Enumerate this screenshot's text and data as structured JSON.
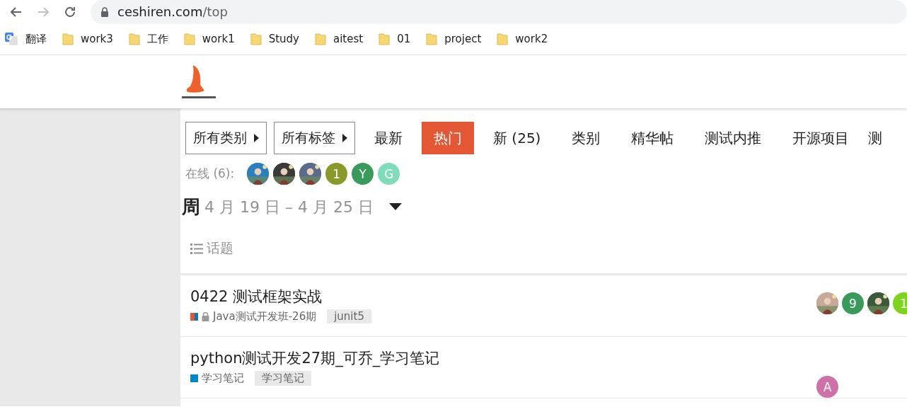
{
  "browser": {
    "url_host": "ceshiren.com",
    "url_path": "/top",
    "bookmarks": [
      {
        "kind": "translate",
        "label": "翻译"
      },
      {
        "kind": "folder",
        "label": "work3"
      },
      {
        "kind": "folder",
        "label": "工作"
      },
      {
        "kind": "folder",
        "label": "work1"
      },
      {
        "kind": "folder",
        "label": "Study"
      },
      {
        "kind": "folder",
        "label": "aitest"
      },
      {
        "kind": "folder",
        "label": "01"
      },
      {
        "kind": "folder",
        "label": "project"
      },
      {
        "kind": "folder",
        "label": "work2"
      }
    ]
  },
  "filters": [
    {
      "label": "所有类别"
    },
    {
      "label": "所有标签"
    }
  ],
  "nav": [
    {
      "label": "最新",
      "selected": false
    },
    {
      "label": "热门",
      "selected": true
    },
    {
      "label": "新 (25)",
      "selected": false
    },
    {
      "label": "类别",
      "selected": false
    },
    {
      "label": "精华帖",
      "selected": false
    },
    {
      "label": "测试内推",
      "selected": false
    },
    {
      "label": "开源项目",
      "selected": false
    },
    {
      "label": "测",
      "selected": false
    }
  ],
  "online": {
    "label": "在线 (6):",
    "users": [
      {
        "kind": "picture",
        "color": "#2a7fc0"
      },
      {
        "kind": "picture",
        "color": "#3a3a3a"
      },
      {
        "kind": "picture",
        "color": "#5a6a8a"
      },
      {
        "kind": "letter",
        "letter": "1",
        "color": "#8a9a2a"
      },
      {
        "kind": "letter",
        "letter": "Y",
        "color": "#3a9a5a"
      },
      {
        "kind": "letter",
        "letter": "G",
        "color": "#7fdcb8"
      }
    ]
  },
  "period": {
    "unit": "周",
    "range": "4 月 19 日 – 4 月 25 日"
  },
  "topics_heading": "话题",
  "topics": [
    {
      "title": "0422 测试框架实战",
      "locked": true,
      "category": "Java测试开发班-26期",
      "category_badge": [
        {
          "color": "#e45735"
        },
        {
          "color": "#0e76bd"
        }
      ],
      "tag": "junit5",
      "posters": [
        {
          "kind": "picture",
          "color": "#c8a898"
        },
        {
          "kind": "letter",
          "letter": "9",
          "color": "#3a9a5a"
        },
        {
          "kind": "picture",
          "color": "#3a5a3a"
        },
        {
          "kind": "letter",
          "letter": "1",
          "color": "#7ed321"
        }
      ]
    },
    {
      "title": "python测试开发27期_可乔_学习笔记",
      "locked": false,
      "category": "学习笔记",
      "category_badge": [
        {
          "color": "#0088cc"
        }
      ],
      "tag": "学习笔记",
      "posters": [
        {
          "kind": "letter",
          "letter": "A",
          "color": "#d070a8"
        }
      ]
    }
  ]
}
